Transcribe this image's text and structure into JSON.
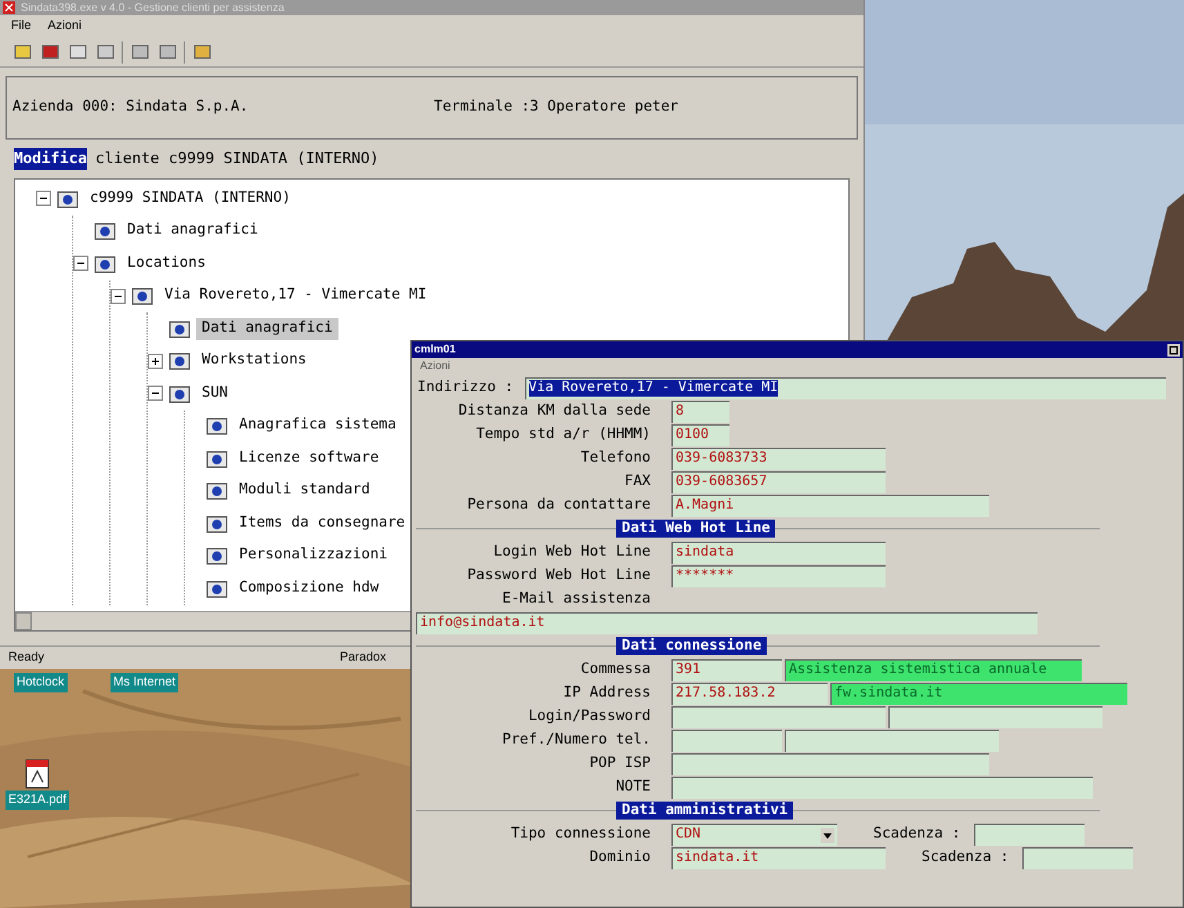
{
  "main_window": {
    "title": "Sindata398.exe v 4.0 - Gestione clienti per assistenza",
    "menu": [
      "File",
      "Azioni"
    ],
    "info": {
      "company": "Azienda 000: Sindata S.p.A.",
      "terminal": "Terminale :3 Operatore peter"
    },
    "heading": {
      "action": "Modifica",
      "text": "cliente c9999 SINDATA (INTERNO)"
    },
    "tree": [
      {
        "label": "c9999 SINDATA (INTERNO)",
        "selected": false,
        "expanded": true,
        "children": [
          {
            "label": "Dati anagrafici",
            "selected": false
          },
          {
            "label": "Locations",
            "selected": false,
            "expanded": true,
            "children": [
              {
                "label": "Via Rovereto,17 - Vimercate MI",
                "selected": false,
                "expanded": true,
                "children": [
                  {
                    "label": "Dati anagrafici",
                    "selected": true
                  },
                  {
                    "label": "Workstations",
                    "selected": false,
                    "expanded": false
                  },
                  {
                    "label": "SUN",
                    "selected": false,
                    "expanded": true,
                    "children": [
                      {
                        "label": "Anagrafica sistema",
                        "selected": false
                      },
                      {
                        "label": "Licenze software",
                        "selected": false
                      },
                      {
                        "label": "Moduli standard",
                        "selected": false
                      },
                      {
                        "label": "Items da consegnare",
                        "selected": false
                      },
                      {
                        "label": "Personalizzazioni",
                        "selected": false
                      },
                      {
                        "label": "Composizione hdw",
                        "selected": false
                      }
                    ]
                  }
                ]
              }
            ]
          }
        ]
      }
    ],
    "status_bar": [
      "Ready",
      "Paradox"
    ]
  },
  "desktop_icons": [
    {
      "label": "Hotclock",
      "kind": "shortcut"
    },
    {
      "label": "Ms Internet",
      "kind": "shortcut"
    },
    {
      "label": "E321A.pdf",
      "kind": "pdf"
    }
  ],
  "dialog": {
    "title": "cmlm01",
    "menu": [
      "Azioni"
    ],
    "rows": [
      {
        "kind": "inline",
        "label": "Indirizzo :",
        "inputs": [
          {
            "kind": "wide",
            "value": "Via Rovereto,17 - Vimercate MI",
            "selected": true
          }
        ]
      },
      {
        "kind": "row",
        "label": "Distanza KM dalla sede",
        "inputs": [
          {
            "kind": "tiny",
            "value": "8"
          }
        ]
      },
      {
        "kind": "row",
        "label": "Tempo std a/r (HHMM)",
        "inputs": [
          {
            "kind": "tiny",
            "value": "0100"
          }
        ]
      },
      {
        "kind": "row",
        "label": "Telefono",
        "inputs": [
          {
            "kind": "medium",
            "value": "039-6083733"
          }
        ]
      },
      {
        "kind": "row",
        "label": "FAX",
        "inputs": [
          {
            "kind": "medium",
            "value": "039-6083657"
          }
        ]
      },
      {
        "kind": "row",
        "label": "Persona da contattare",
        "inputs": [
          {
            "kind": "long",
            "value": "A.Magni"
          }
        ]
      },
      {
        "kind": "header",
        "label": "Dati Web Hot Line"
      },
      {
        "kind": "row",
        "label": "Login Web Hot Line",
        "inputs": [
          {
            "kind": "medium",
            "value": "sindata"
          }
        ]
      },
      {
        "kind": "row",
        "label": "Password Web Hot Line",
        "inputs": [
          {
            "kind": "medium",
            "value": "*******"
          }
        ]
      },
      {
        "kind": "row",
        "label": "E-Mail assistenza"
      },
      {
        "kind": "email",
        "inputs": [
          {
            "kind": "wide",
            "value": "info@sindata.it"
          }
        ]
      },
      {
        "kind": "header",
        "label": "Dati connessione"
      },
      {
        "kind": "row",
        "label": "Commessa",
        "inputs": [
          {
            "kind": "small",
            "value": "391"
          },
          {
            "kind": "lookup",
            "value": "Assistenza sistemistica annuale"
          }
        ]
      },
      {
        "kind": "row",
        "label": "IP Address",
        "inputs": [
          {
            "kind": "half",
            "value": "217.58.183.2"
          },
          {
            "kind": "lookup",
            "value": "fw.sindata.it"
          }
        ]
      },
      {
        "kind": "row",
        "label": "Login/Password",
        "inputs": [
          {
            "kind": "medium"
          },
          {
            "kind": "medium"
          }
        ]
      },
      {
        "kind": "row",
        "label": "Pref./Numero tel.",
        "inputs": [
          {
            "kind": "small"
          },
          {
            "kind": "medium"
          }
        ]
      },
      {
        "kind": "row",
        "label": "POP ISP",
        "inputs": [
          {
            "kind": "long"
          }
        ]
      },
      {
        "kind": "row",
        "label": "NOTE",
        "inputs": [
          {
            "kind": "full"
          }
        ]
      },
      {
        "kind": "header",
        "label": "Dati amministrativi"
      },
      {
        "kind": "row",
        "label": "Tipo connessione",
        "inputs": [
          {
            "kind": "dropdown",
            "value": "CDN"
          },
          {
            "kind": "label",
            "value": "Scadenza :"
          },
          {
            "kind": "small"
          }
        ]
      },
      {
        "kind": "row",
        "label": "Dominio",
        "inputs": [
          {
            "kind": "medium",
            "value": "sindata.it"
          },
          {
            "kind": "label",
            "value": "Scadenza :"
          },
          {
            "kind": "small"
          }
        ]
      }
    ]
  }
}
